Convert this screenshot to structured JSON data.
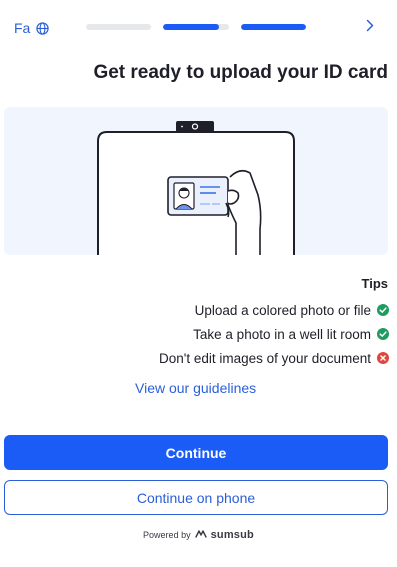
{
  "header": {
    "language_label": "Fa",
    "language_icon": "globe-icon",
    "next_icon": "chevron-right-icon",
    "progress_steps": [
      {
        "fill_fraction": 0.0
      },
      {
        "fill_fraction": 0.85
      },
      {
        "fill_fraction": 1.0
      }
    ]
  },
  "main": {
    "title": "Get ready to upload your ID card",
    "illustration_icon": "id-card-in-front-of-camera-illustration",
    "tips_title": "Tips",
    "tips": [
      {
        "text": "Upload a colored photo or file",
        "status": "check-circle-icon",
        "color": "#1f9a61"
      },
      {
        "text": "Take a photo in a well lit room",
        "status": "check-circle-icon",
        "color": "#1f9a61"
      },
      {
        "text": "Don't edit images of your document",
        "status": "x-circle-icon",
        "color": "#e0463d"
      }
    ],
    "guidelines_link": "View our guidelines"
  },
  "actions": {
    "continue_label": "Continue",
    "continue_on_phone_label": "Continue on phone"
  },
  "footer": {
    "powered_by": "Powered by",
    "brand": "sumsub"
  },
  "colors": {
    "accent": "#1a5cf5",
    "link": "#2b5fd9",
    "success": "#1f9a61",
    "error": "#e0463d",
    "illustration_bg": "#f1f5fd"
  }
}
